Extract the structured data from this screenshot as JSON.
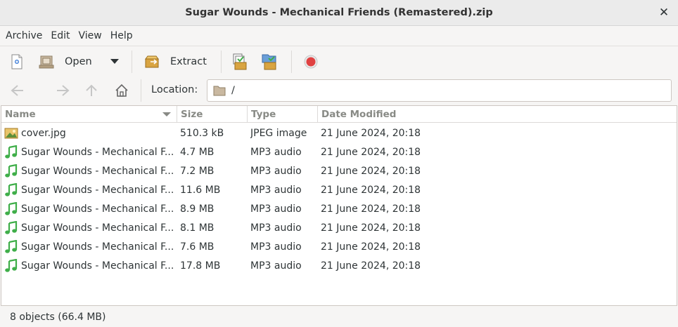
{
  "window": {
    "title": "Sugar Wounds - Mechanical Friends (Remastered).zip",
    "close_glyph": "✕"
  },
  "menubar": {
    "items": [
      "Archive",
      "Edit",
      "View",
      "Help"
    ]
  },
  "toolbar": {
    "open_label": "Open",
    "extract_label": "Extract",
    "icons": [
      "new-archive-icon",
      "open-archive-icon",
      "dropdown-arrow-icon",
      "extract-icon",
      "add-files-icon",
      "add-folder-icon",
      "stop-icon"
    ]
  },
  "navigation": {
    "location_label": "Location:",
    "location_value": "/",
    "icons": [
      "back-icon",
      "forward-icon",
      "up-icon",
      "home-icon",
      "folder-icon"
    ]
  },
  "filelist": {
    "columns": [
      "Name",
      "Size",
      "Type",
      "Date Modified"
    ],
    "sort_column": "Name",
    "rows": [
      {
        "name": "cover.jpg",
        "size": "510.3 kB",
        "type": "JPEG image",
        "date": "21 June 2024, 20:18",
        "icon": "image-file-icon"
      },
      {
        "name": "Sugar Wounds - Mechanical F...",
        "size": "4.7 MB",
        "type": "MP3 audio",
        "date": "21 June 2024, 20:18",
        "icon": "music-note-icon"
      },
      {
        "name": "Sugar Wounds - Mechanical F...",
        "size": "7.2 MB",
        "type": "MP3 audio",
        "date": "21 June 2024, 20:18",
        "icon": "music-note-icon"
      },
      {
        "name": "Sugar Wounds - Mechanical F...",
        "size": "11.6 MB",
        "type": "MP3 audio",
        "date": "21 June 2024, 20:18",
        "icon": "music-note-icon"
      },
      {
        "name": "Sugar Wounds - Mechanical F...",
        "size": "8.9 MB",
        "type": "MP3 audio",
        "date": "21 June 2024, 20:18",
        "icon": "music-note-icon"
      },
      {
        "name": "Sugar Wounds - Mechanical F...",
        "size": "8.1 MB",
        "type": "MP3 audio",
        "date": "21 June 2024, 20:18",
        "icon": "music-note-icon"
      },
      {
        "name": "Sugar Wounds - Mechanical F...",
        "size": "7.6 MB",
        "type": "MP3 audio",
        "date": "21 June 2024, 20:18",
        "icon": "music-note-icon"
      },
      {
        "name": "Sugar Wounds - Mechanical F...",
        "size": "17.8 MB",
        "type": "MP3 audio",
        "date": "21 June 2024, 20:18",
        "icon": "music-note-icon"
      }
    ]
  },
  "statusbar": {
    "text": "8 objects (66.4 MB)"
  },
  "colors": {
    "music_icon": "#3fae49",
    "stop_button": "#e04141",
    "titlebar": "#ebebeb",
    "window_bg": "#f6f5f4"
  }
}
